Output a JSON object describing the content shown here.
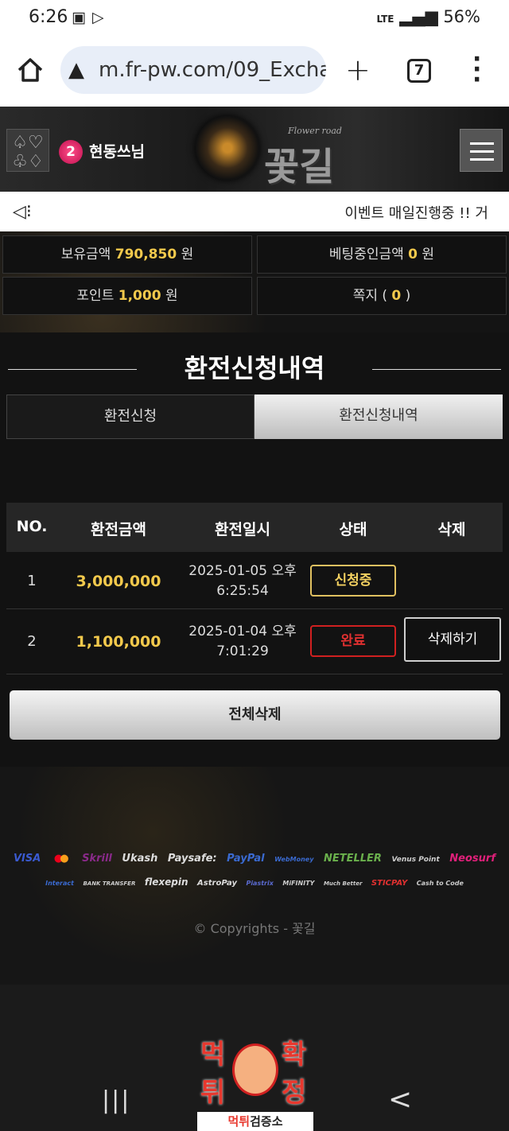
{
  "status_bar": {
    "time": "6:26",
    "network": "LTE",
    "battery": "56%"
  },
  "browser": {
    "url": "m.fr-pw.com/09_Excha",
    "tab_count": "7"
  },
  "header": {
    "level": "2",
    "username": "현동쓰님",
    "logo_text": "꽃길",
    "logo_sub": "Flower road"
  },
  "notice": {
    "text": "이벤트 매일진행중 !! 거"
  },
  "info": {
    "balance_label": "보유금액",
    "balance_value": "790,850",
    "balance_unit": "원",
    "betting_label": "베팅중인금액",
    "betting_value": "0",
    "betting_unit": "원",
    "point_label": "포인트",
    "point_value": "1,000",
    "point_unit": "원",
    "memo_label": "쪽지",
    "memo_open": "(",
    "memo_value": "0",
    "memo_close": ")"
  },
  "page": {
    "title": "환전신청내역",
    "tabs": [
      {
        "label": "환전신청"
      },
      {
        "label": "환전신청내역"
      }
    ]
  },
  "table": {
    "headers": {
      "no": "NO.",
      "amount": "환전금액",
      "date": "환전일시",
      "status": "상태",
      "delete": "삭제"
    },
    "rows": [
      {
        "no": "1",
        "amount": "3,000,000",
        "date1": "2025-01-05 오후",
        "date2": "6:25:54",
        "status": "신청중",
        "delete": ""
      },
      {
        "no": "2",
        "amount": "1,100,000",
        "date1": "2025-01-04 오후",
        "date2": "7:01:29",
        "status": "완료",
        "delete": "삭제하기"
      }
    ]
  },
  "delete_all": "전체삭제",
  "payments_row1": [
    "VISA",
    "Skrill",
    "Ukash",
    "Paysafe:",
    "PayPal",
    "WebMoney",
    "NETELLER",
    "Venus Point",
    "Neosurf"
  ],
  "payments_row2": [
    "Interact",
    "BANK TRANSFER",
    "flexepin",
    "AstroPay",
    "Piastrix",
    "MiFINITY",
    "Much Better",
    "STICPAY",
    "Cash to Code"
  ],
  "copyright": "© Copyrights - 꽃길",
  "watermark": {
    "c1": "먹",
    "c2": "확",
    "c3": "튀",
    "c4": "정",
    "caption_red": "먹튀",
    "caption_dark": "검증소"
  },
  "colors": {
    "gold": "#f2c94c",
    "red": "#e03030",
    "panel": "#121212"
  }
}
